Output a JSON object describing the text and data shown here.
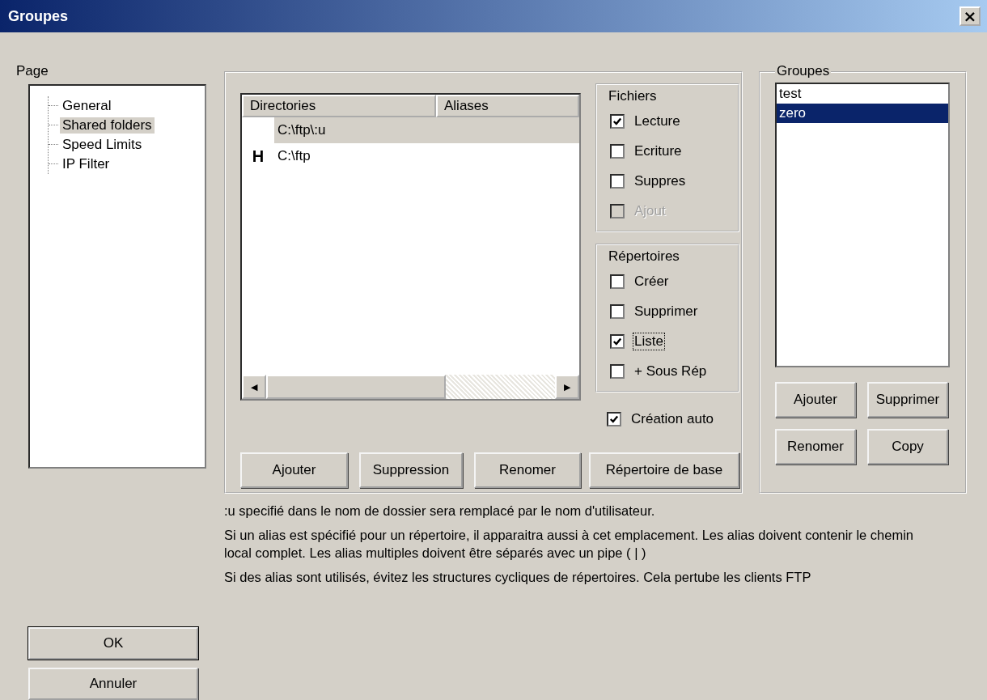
{
  "window": {
    "title": "Groupes",
    "close": "×"
  },
  "page_label": "Page",
  "tree": [
    {
      "label": "General",
      "selected": false
    },
    {
      "label": "Shared folders",
      "selected": true
    },
    {
      "label": "Speed Limits",
      "selected": false
    },
    {
      "label": "IP Filter",
      "selected": false
    }
  ],
  "directories": {
    "columns": [
      "Directories",
      "Aliases"
    ],
    "rows": [
      {
        "flag": "",
        "directory": "C:\\ftp\\:u",
        "selected": true
      },
      {
        "flag": "H",
        "directory": "C:\\ftp",
        "selected": false
      }
    ],
    "scroll_left": "◀",
    "scroll_right": "▶"
  },
  "fichiers": {
    "title": "Fichiers",
    "options": [
      {
        "label": "Lecture",
        "checked": true,
        "disabled": false,
        "focused": false
      },
      {
        "label": "Ecriture",
        "checked": false,
        "disabled": false,
        "focused": false
      },
      {
        "label": "Suppres",
        "checked": false,
        "disabled": false,
        "focused": false
      },
      {
        "label": "Ajout",
        "checked": false,
        "disabled": true,
        "focused": false
      }
    ]
  },
  "repertoires": {
    "title": "Répertoires",
    "options": [
      {
        "label": "Créer",
        "checked": false,
        "disabled": false,
        "focused": false
      },
      {
        "label": "Supprimer",
        "checked": false,
        "disabled": false,
        "focused": false
      },
      {
        "label": "Liste",
        "checked": true,
        "disabled": false,
        "focused": true
      },
      {
        "label": "+ Sous Rép",
        "checked": false,
        "disabled": false,
        "focused": false
      }
    ]
  },
  "auto_create": {
    "label": "Création auto",
    "checked": true
  },
  "dir_buttons": [
    "Ajouter",
    "Suppression",
    "Renomer",
    "Répertoire de base"
  ],
  "groups": {
    "title": "Groupes",
    "items": [
      {
        "label": "test",
        "selected": false
      },
      {
        "label": "zero",
        "selected": true
      }
    ],
    "buttons": [
      "Ajouter",
      "Supprimer",
      "Renomer",
      "Copy"
    ]
  },
  "notes": [
    ":u specifié dans le nom de dossier sera remplacé par le nom d'utilisateur.",
    "Si un alias est spécifié pour un répertoire, il apparaitra aussi à cet emplacement. Les alias doivent contenir le chemin local complet. Les alias multiples doivent être séparés avec un pipe ( | )",
    "Si des alias sont utilisés, évitez les structures cycliques de répertoires. Cela pertube les clients FTP"
  ],
  "buttons": [
    "OK",
    "Annuler"
  ]
}
